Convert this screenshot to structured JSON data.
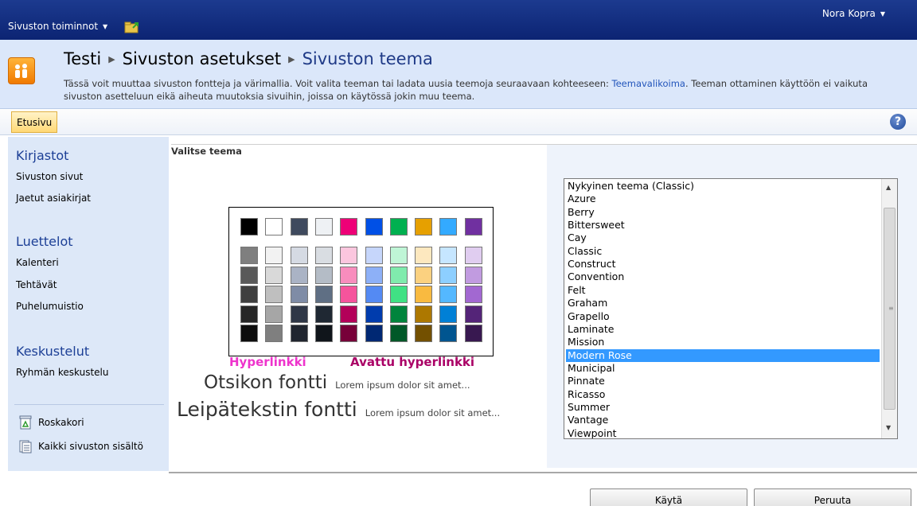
{
  "topbar": {
    "site_actions_label": "Sivuston toiminnot",
    "user_name": "Nora Kopra"
  },
  "title_area": {
    "breadcrumb": [
      "Testi",
      "Sivuston asetukset",
      "Sivuston teema"
    ],
    "description_part1": "Tässä voit muuttaa sivuston fontteja ja värimallia. Voit valita teeman tai ladata uusia teemoja seuraavaan kohteeseen: ",
    "description_link": "Teemavalikoima",
    "description_part2": ". Teeman ottaminen käyttöön ei vaikuta sivuston asetteluun eikä aiheuta muutoksia sivuihin, joissa on käytössä jokin muu teema."
  },
  "topnav": {
    "home_tab": "Etusivu",
    "help_glyph": "?"
  },
  "leftnav": {
    "libraries_heading": "Kirjastot",
    "libraries": [
      "Sivuston sivut",
      "Jaetut asiakirjat"
    ],
    "lists_heading": "Luettelot",
    "lists": [
      "Kalenteri",
      "Tehtävät",
      "Puhelumuistio"
    ],
    "discussions_heading": "Keskustelut",
    "discussions": [
      "Ryhmän keskustelu"
    ],
    "recycle_bin": "Roskakori",
    "all_content": "Kaikki sivuston sisältö"
  },
  "main": {
    "section_title": "Valitse teema",
    "hyperlink_sample": "Hyperlinkki",
    "visited_link_sample": "Avattu hyperlinkki",
    "heading_font_sample": "Otsikon fontti",
    "body_font_sample": "Leipätekstin fontti",
    "lorem": "Lorem ipsum dolor sit amet...",
    "colors": {
      "hyperlink": "#ee33cc",
      "visited_link": "#aa0066"
    }
  },
  "theme_list": {
    "options": [
      "Nykyinen teema (Classic)",
      "Azure",
      "Berry",
      "Bittersweet",
      "Cay",
      "Classic",
      "Construct",
      "Convention",
      "Felt",
      "Graham",
      "Grapello",
      "Laminate",
      "Mission",
      "Modern Rose",
      "Municipal",
      "Pinnate",
      "Ricasso",
      "Summer",
      "Vantage",
      "Viewpoint"
    ],
    "selected": "Modern Rose"
  },
  "buttons": {
    "apply": "Käytä",
    "cancel": "Peruuta"
  }
}
